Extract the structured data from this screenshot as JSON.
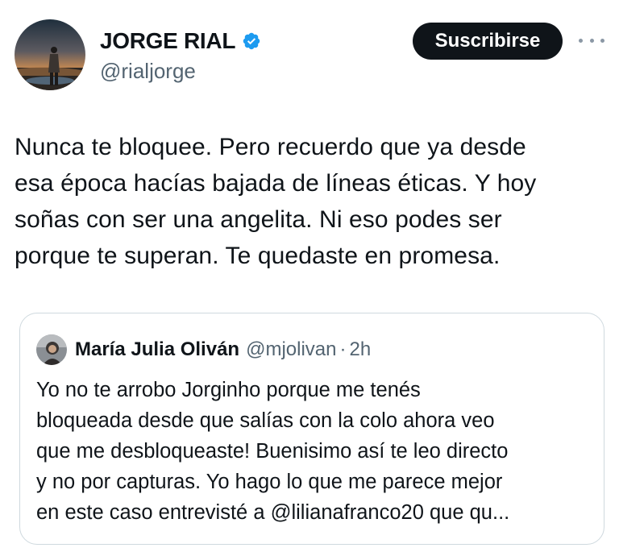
{
  "tweet": {
    "author": {
      "name": "JORGE RIAL",
      "handle": "@rialjorge",
      "verified_icon": "verified-badge-icon",
      "verified_color": "#1d9bf0"
    },
    "subscribe_label": "Suscribirse",
    "more_icon": "more-options-icon",
    "text": "Nunca te bloquee. Pero recuerdo que ya desde\nesa época hacías bajada de líneas éticas. Y hoy\nsoñas con ser una angelita. Ni eso podes ser\nporque te superan. Te quedaste en promesa."
  },
  "quoted_tweet": {
    "author": {
      "name": "María Julia Oliván",
      "handle": "@mjolivan"
    },
    "separator": "·",
    "time": "2h",
    "text": "Yo no te arrobo Jorginho porque me tenés\nbloqueada desde que salías con la colo ahora veo\nque me desbloqueaste! Buenisimo así te leo directo\ny no por capturas. Yo hago lo que me parece mejor\nen este caso entrevisté a @lilianafranco20 que qu..."
  },
  "colors": {
    "text": "#0f1419",
    "secondary_text": "#536471",
    "button_bg": "#0f1419",
    "border": "#cfd9de"
  }
}
